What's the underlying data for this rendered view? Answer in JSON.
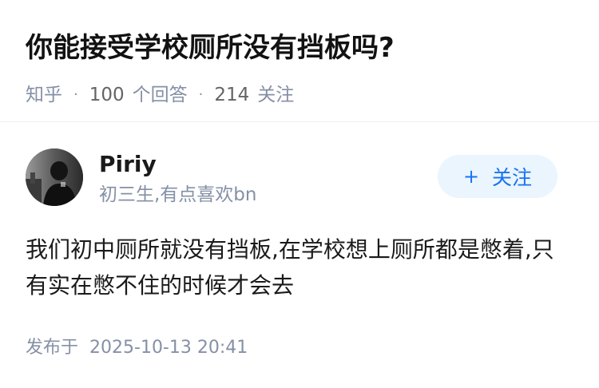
{
  "question": {
    "title": "你能接受学校厕所没有挡板吗?",
    "source": "知乎",
    "answers_count": "100",
    "answers_label": "个回答",
    "followers_count": "214",
    "followers_label": "关注"
  },
  "author": {
    "name": "Piriy",
    "bio": "初三生,有点喜欢bn",
    "avatar_icon": "avatar-photo"
  },
  "follow_button": {
    "icon": "plus-icon",
    "label": "关注",
    "bg_color": "#ebf5fd",
    "text_color": "#1772f6"
  },
  "answer": {
    "content": "我们初中厕所就没有挡板,在学校想上厕所都是憋着,只有实在憋不住的时候才会去",
    "published_label": "发布于",
    "published_time": "2025-10-13 20:41"
  }
}
